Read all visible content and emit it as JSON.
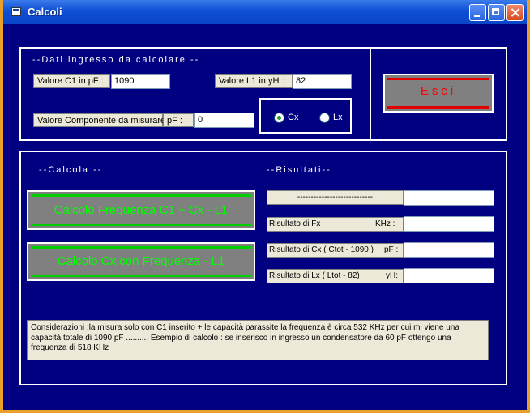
{
  "window": {
    "title": "Calcoli"
  },
  "input_group": {
    "title": "--Dati ingresso da calcolare --",
    "c1_label": "Valore C1 in pF :",
    "c1_value": "1090",
    "l1_label": "Valore L1 in yH :",
    "l1_value": "82",
    "comp_label": "Valore Componente da misurare",
    "unit_label": "pF :",
    "comp_value": "0",
    "radio_cx": "Cx",
    "radio_lx": "Lx",
    "selected": "Cx"
  },
  "exit_button": "Esci",
  "calc_group": {
    "calc_title": "--Calcola --",
    "results_title": "--Risultati--",
    "btn_freq": "Calcolo Frequenza C1 + Cx - L1",
    "btn_cx": "Calcolo Cx con Frequenza - L1",
    "header_label": "----------------------------",
    "fx_label": "Risultato di Fx",
    "fx_unit": "KHz :",
    "cx_label": "Risultato di Cx ( Ctot - 1090 )",
    "cx_unit": "pF :",
    "lx_label": "Risultato di Lx ( Ltot - 82)",
    "lx_unit": "yH:",
    "header_value": "",
    "fx_value": "",
    "cx_value": "",
    "lx_value": ""
  },
  "note": "Considerazioni :la misura solo con C1 inserito + le capacità parassite la frequenza è circa 532 KHz per  cui mi viene una capacità totale di 1090 pF ..........  Esempio di calcolo : se inserisco in ingresso un condensatore da 60 pF ottengo una frequenza di 518 KHz"
}
